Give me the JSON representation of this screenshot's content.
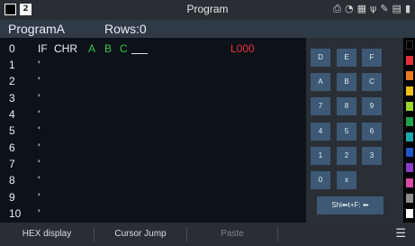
{
  "window": {
    "title": "Program",
    "badge": "2"
  },
  "status_icons": [
    "printer-icon",
    "wifi-icon",
    "network-icon",
    "usb-icon",
    "tool-icon",
    "clipboard-icon",
    "battery-icon"
  ],
  "header": {
    "program_name": "ProgramA",
    "rows": "Rows:0"
  },
  "editor": {
    "lines": [
      {
        "num": "0",
        "tick": "",
        "tokens": [
          "IF",
          "CHR",
          "A",
          "B",
          "C"
        ],
        "label": "L000"
      },
      {
        "num": "1",
        "tick": "'"
      },
      {
        "num": "2",
        "tick": "'"
      },
      {
        "num": "3",
        "tick": "'"
      },
      {
        "num": "4",
        "tick": "'"
      },
      {
        "num": "5",
        "tick": "'"
      },
      {
        "num": "6",
        "tick": "'"
      },
      {
        "num": "7",
        "tick": "'"
      },
      {
        "num": "8",
        "tick": "'"
      },
      {
        "num": "9",
        "tick": "'"
      },
      {
        "num": "10",
        "tick": "'"
      }
    ]
  },
  "keypad": {
    "keys": [
      "D",
      "E",
      "F",
      "A",
      "B",
      "C",
      "7",
      "8",
      "9",
      "4",
      "5",
      "6",
      "1",
      "2",
      "3",
      "0",
      "x"
    ],
    "shift_label": "Shi⬅t+F: ⬅"
  },
  "palette": {
    "colors": [
      "#000000",
      "#e0303a",
      "#e87a1e",
      "#f0c018",
      "#9bd42a",
      "#1fa24a",
      "#1aa8b0",
      "#1e56c8",
      "#8a3ac8",
      "#d84aa8",
      "#8e8e8e",
      "#ffffff"
    ]
  },
  "bottombar": {
    "hex_label": "HEX display",
    "jump_label": "Cursor Jump",
    "paste_label": "Paste"
  }
}
